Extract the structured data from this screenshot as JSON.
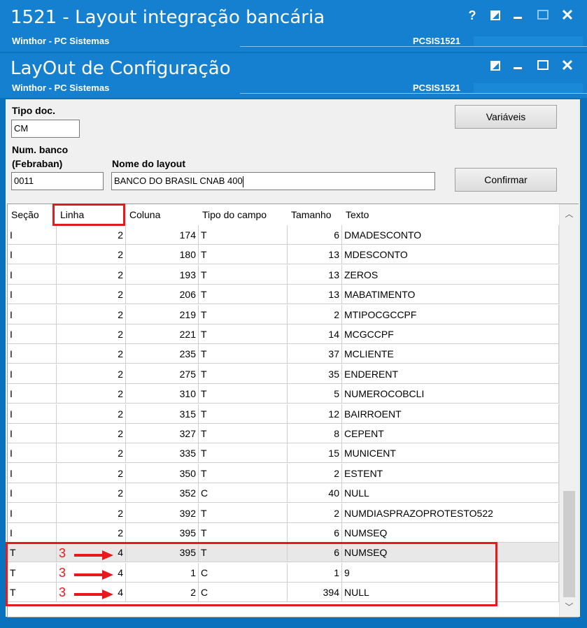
{
  "window1": {
    "title": "1521 - Layout integração bancária",
    "subtitle": "Winthor - PC Sistemas",
    "program_code": "PCSIS1521",
    "buttons": [
      "?",
      "restore",
      "minimize",
      "maximize",
      "close"
    ]
  },
  "window2": {
    "title": "LayOut de Configuração",
    "subtitle": "Winthor - PC Sistemas",
    "program_code": "PCSIS1521",
    "buttons": [
      "restore",
      "minimize",
      "maximize",
      "close"
    ]
  },
  "form": {
    "tipo_doc_label": "Tipo doc.",
    "tipo_doc_value": "CM",
    "num_banco_label_1": "Num. banco",
    "num_banco_label_2": "(Febraban)",
    "num_banco_value": "0011",
    "nome_layout_label": "Nome do layout",
    "nome_layout_value": "BANCO DO BRASIL CNAB 400",
    "variaveis_button": "Variáveis",
    "confirmar_button": "Confirmar"
  },
  "grid": {
    "columns": [
      "Seção",
      "Linha",
      "Coluna",
      "Tipo do campo",
      "Tamanho",
      "Texto"
    ],
    "rows": [
      [
        "I",
        "2",
        "174",
        "T",
        "6",
        "DMADESCONTO"
      ],
      [
        "I",
        "2",
        "180",
        "T",
        "13",
        "MDESCONTO"
      ],
      [
        "I",
        "2",
        "193",
        "T",
        "13",
        "ZEROS"
      ],
      [
        "I",
        "2",
        "206",
        "T",
        "13",
        "MABATIMENTO"
      ],
      [
        "I",
        "2",
        "219",
        "T",
        "2",
        "MTIPOCGCCPF"
      ],
      [
        "I",
        "2",
        "221",
        "T",
        "14",
        "MCGCCPF"
      ],
      [
        "I",
        "2",
        "235",
        "T",
        "37",
        "MCLIENTE"
      ],
      [
        "I",
        "2",
        "275",
        "T",
        "35",
        "ENDERENT"
      ],
      [
        "I",
        "2",
        "310",
        "T",
        "5",
        "NUMEROCOBCLI"
      ],
      [
        "I",
        "2",
        "315",
        "T",
        "12",
        "BAIRROENT"
      ],
      [
        "I",
        "2",
        "327",
        "T",
        "8",
        "CEPENT"
      ],
      [
        "I",
        "2",
        "335",
        "T",
        "15",
        "MUNICENT"
      ],
      [
        "I",
        "2",
        "350",
        "T",
        "2",
        "ESTENT"
      ],
      [
        "I",
        "2",
        "352",
        "C",
        "40",
        "NULL"
      ],
      [
        "I",
        "2",
        "392",
        "T",
        "2",
        "NUMDIASPRAZOPROTESTO522"
      ],
      [
        "I",
        "2",
        "395",
        "T",
        "6",
        "NUMSEQ"
      ],
      [
        "T",
        "4",
        "395",
        "T",
        "6",
        "NUMSEQ"
      ],
      [
        "T",
        "4",
        "1",
        "C",
        "1",
        "9"
      ],
      [
        "T",
        "4",
        "2",
        "C",
        "394",
        "NULL"
      ]
    ],
    "selected_row": 16
  },
  "annotations": {
    "marker": "3",
    "color": "#e8191c"
  }
}
